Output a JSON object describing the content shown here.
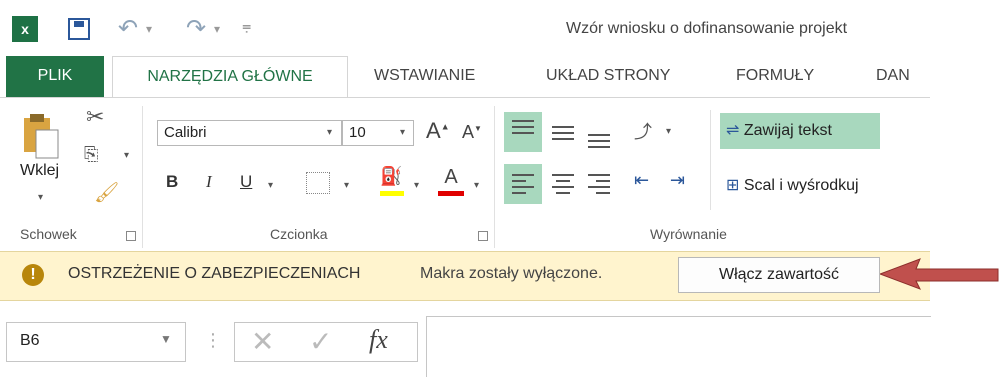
{
  "qat": {
    "app_icon_text": "x",
    "title": "Wzór wniosku o dofinansowanie projekt"
  },
  "tabs": [
    {
      "label": "PLIK"
    },
    {
      "label": "NARZĘDZIA GŁÓWNE"
    },
    {
      "label": "WSTAWIANIE"
    },
    {
      "label": "UKŁAD STRONY"
    },
    {
      "label": "FORMUŁY"
    },
    {
      "label": "DAN"
    }
  ],
  "ribbon": {
    "clipboard": {
      "paste_label": "Wklej",
      "group_label": "Schowek"
    },
    "font": {
      "font_name": "Calibri",
      "font_size": "10",
      "bold": "B",
      "italic": "I",
      "underline": "U",
      "group_label": "Czcionka"
    },
    "alignment": {
      "wrap_text": "Zawijaj tekst",
      "merge_center": "Scal i wyśrodkuj",
      "group_label": "Wyrównanie"
    }
  },
  "message_bar": {
    "icon_text": "!",
    "title": "OSTRZEŻENIE O ZABEZPIECZENIACH",
    "message": "Makra zostały wyłączone.",
    "enable_button": "Włącz zawartość"
  },
  "formula_bar": {
    "name_box": "B6",
    "fx_label": "fx",
    "formula": ""
  },
  "colors": {
    "excel_green": "#217346",
    "highlight_green": "#a8d8be",
    "message_bar_bg": "#fff4ce",
    "arrow_red": "#c0504d"
  }
}
